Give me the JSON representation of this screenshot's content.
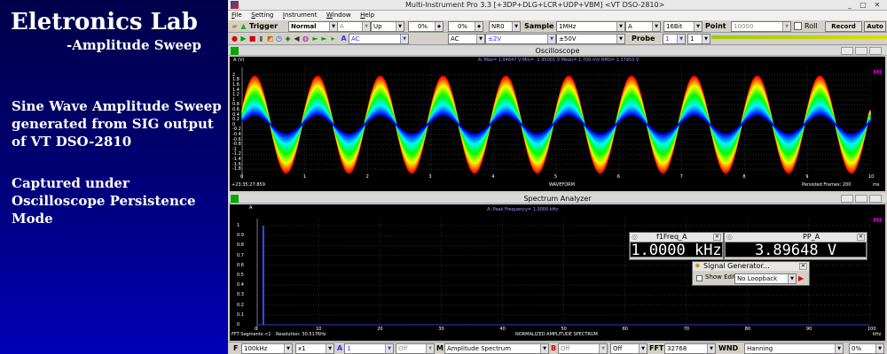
{
  "slide": {
    "title": "Eletronics Lab",
    "subtitle": "-Amplitude Sweep",
    "desc1": "Sine Wave Amplitude Sweep generated from SIG output of VT DSO-2810",
    "desc2": "Captured under Oscilloscope Persistence Mode"
  },
  "window": {
    "title": "Multi-Instrument Pro 3.3    [+3DP+DLG+LCR+UDP+VBM]    <VT DSO-2810>",
    "min": "_",
    "max": "□",
    "close": "✕"
  },
  "menu": [
    {
      "first": "F",
      "rest": "ile"
    },
    {
      "first": "S",
      "rest": "etting"
    },
    {
      "first": "I",
      "rest": "nstrument"
    },
    {
      "first": "W",
      "rest": "indow"
    },
    {
      "first": "H",
      "rest": "elp"
    }
  ],
  "toolbar1": {
    "trigger": "Trigger",
    "mode": "Normal",
    "channel": "A",
    "edge": "Up",
    "level1": "0%",
    "level2": "0%",
    "nr": "NR0",
    "sample": "Sample",
    "rate": "1MHz",
    "chan2": "A",
    "bits": "16Bit",
    "point": "Point",
    "points": "10000",
    "roll": "Roll",
    "record": "Record",
    "auto": "Auto"
  },
  "toolbar2": {
    "coupling_a": "AC",
    "coupling_b": "AC",
    "range_a": "±2V",
    "range_b": "±50V",
    "probe": "Probe",
    "probe_a": "1",
    "probe_b": "1"
  },
  "oscilloscope": {
    "title": "Oscilloscope",
    "unit": "A (V)",
    "stats": "A: Max=   1.94647   V  Min= -1.95001   V  Mean=      1.700 mV  RMS=   1.37953   V",
    "timestamp": "+23:35:27:859",
    "xlabel": "WAVEFORM",
    "frames": "Persisted Frames: 200",
    "xunit": "ms",
    "yticks": [
      "2",
      "1.8",
      "1.6",
      "1.4",
      "1.2",
      "1",
      "0.8",
      "0.6",
      "0.4",
      "0.2",
      "0",
      "-0.2",
      "-0.4",
      "-0.6",
      "-0.8",
      "-1",
      "-1.2",
      "-1.4",
      "-1.6",
      "-1.8"
    ],
    "xticks": [
      "0",
      "1",
      "2",
      "3",
      "4",
      "5",
      "6",
      "7",
      "8",
      "9",
      "10"
    ],
    "mi": "MI",
    "wave": {
      "frequency_khz": 1.0,
      "cycles": 10,
      "amplitude_max": 1.94647,
      "amplitude_min": -1.95001
    }
  },
  "spectrum": {
    "title": "Spectrum Analyzer",
    "unit": "A",
    "peak": "A: Peak Frequency=     1.0000   kHz",
    "segments": "FFT Segments:<1",
    "resolution": "Resolution: 30.5176Hz",
    "xlabel": "NORMALIZED AMPLITUDE SPECTRUM",
    "xunit": "kHz",
    "yticks": [
      "1",
      "0.9",
      "0.8",
      "0.7",
      "0.6",
      "0.5",
      "0.4",
      "0.3",
      "0.2",
      "0.1",
      "0"
    ],
    "xticks": [
      "0",
      "10",
      "20",
      "30",
      "40",
      "50",
      "60",
      "70",
      "80",
      "90",
      "100"
    ],
    "mi": "MI",
    "peak_value_khz": 1.0
  },
  "freq_window": {
    "title": "f1Freq_A",
    "value": "1.0000 kHz"
  },
  "pp_window": {
    "title": "PP_A",
    "value": "3.89648 V"
  },
  "siggen": {
    "title": "Signal Generator...",
    "show_editor": "Show Editor",
    "loopback": "No Loopback"
  },
  "bottombar": {
    "f": "F",
    "freq": "100kHz",
    "mult": "x1",
    "a": "A",
    "a_val": "1",
    "off1": "Off",
    "m": "M",
    "mode": "Amplitude Spectrum",
    "b": "B",
    "off2": "Off",
    "off3": "Off",
    "fft": "FFT",
    "fft_size": "32768",
    "wnd": "WND",
    "window": "Hanning",
    "pct": "0%"
  }
}
